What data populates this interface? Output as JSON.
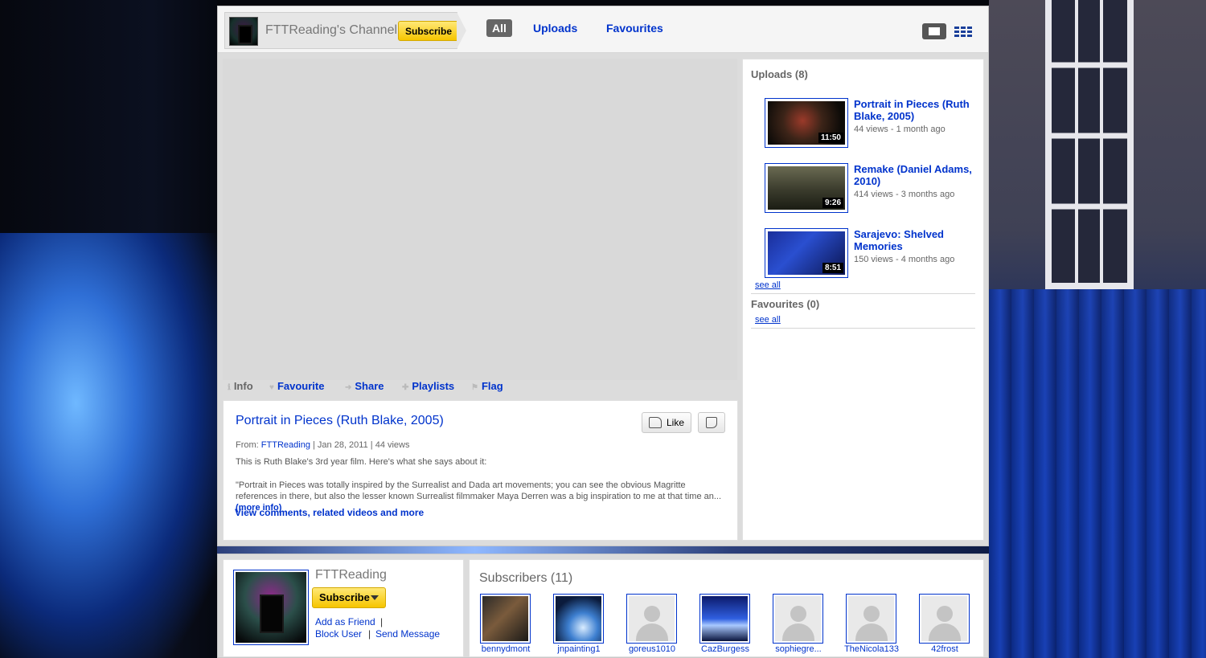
{
  "header": {
    "channel_title": "FTTReading's Channel",
    "subscribe_label": "Subscribe",
    "tabs": [
      {
        "label": "All"
      },
      {
        "label": "Uploads"
      },
      {
        "label": "Favourites"
      }
    ]
  },
  "actions": [
    {
      "label": "Info"
    },
    {
      "label": "Favourite"
    },
    {
      "label": "Share"
    },
    {
      "label": "Playlists"
    },
    {
      "label": "Flag"
    }
  ],
  "video": {
    "title": "Portrait in Pieces (Ruth Blake, 2005)",
    "like_label": "Like",
    "from_label": "From:",
    "uploader": "FTTReading",
    "date": "| Jan 28, 2011",
    "views": "| 44 views",
    "desc_short": "This is Ruth Blake's 3rd year film. Here's what she says about it:",
    "desc_long": "\"Portrait in Pieces was totally inspired by the Surrealist and Dada art movements; you can see the obvious Magritte references in there, but also the lesser known Surrealist filmmaker Maya Derren was a big inspiration to me at that time an...",
    "more_info": "(more info)",
    "view_comments": "View comments, related videos and more"
  },
  "sidebar": {
    "uploads_title": "Uploads (8)",
    "uploads": [
      {
        "title": "Portrait in Pieces (Ruth Blake, 2005)",
        "meta": "44 views - 1 month ago",
        "duration": "11:50"
      },
      {
        "title": "Remake (Daniel Adams, 2010)",
        "meta": "414 views - 3 months ago",
        "duration": "9:26"
      },
      {
        "title": "Sarajevo: Shelved Memories",
        "meta": "150 views - 4 months ago",
        "duration": "8:51"
      }
    ],
    "see_all": "see all",
    "favourites_title": "Favourites (0)"
  },
  "profile": {
    "name": "FTTReading",
    "subscribe_label": "Subscribe",
    "add_friend": "Add as Friend",
    "block_user": "Block User",
    "send_message": "Send Message",
    "separator": "|"
  },
  "subscribers": {
    "title": "Subscribers (11)",
    "items": [
      {
        "name": "bennydmont"
      },
      {
        "name": "jnpainting1"
      },
      {
        "name": "goreus1010"
      },
      {
        "name": "CazBurgess"
      },
      {
        "name": "sophiegre..."
      },
      {
        "name": "TheNicola133"
      },
      {
        "name": "42frost"
      }
    ]
  }
}
